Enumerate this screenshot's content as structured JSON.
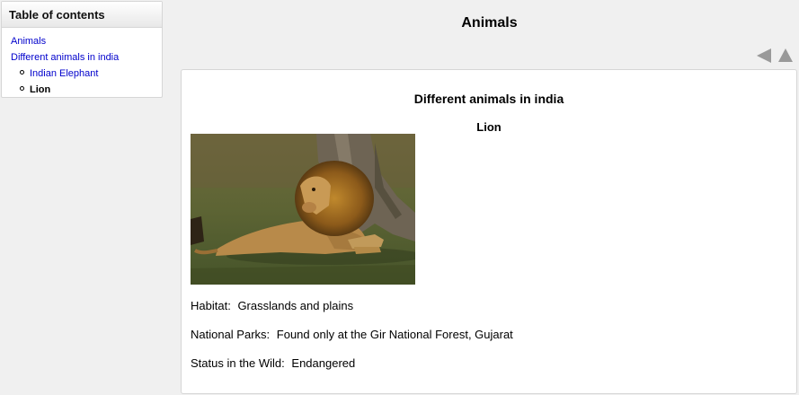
{
  "toc": {
    "title": "Table of contents",
    "items": [
      {
        "label": "Animals"
      },
      {
        "label": "Different animals in india"
      }
    ],
    "subitems": [
      {
        "label": "Indian Elephant"
      },
      {
        "label": "Lion"
      }
    ]
  },
  "page": {
    "title": "Animals"
  },
  "nav": {
    "prev_icon": "triangle-left-icon",
    "up_icon": "triangle-up-icon",
    "arrow_color": "#999999"
  },
  "content": {
    "section_title": "Different animals in india",
    "animal_title": "Lion",
    "image_subject": "lion-photo",
    "facts": [
      {
        "label": "Habitat:",
        "value": "Grasslands and plains"
      },
      {
        "label": "National Parks:",
        "value": "Found only at the Gir National Forest, Gujarat"
      },
      {
        "label": "Status in the Wild:",
        "value": "Endangered"
      }
    ]
  },
  "colors": {
    "link": "#0000cc",
    "background": "#f0f0f0",
    "card_border": "#d6d6d6"
  }
}
